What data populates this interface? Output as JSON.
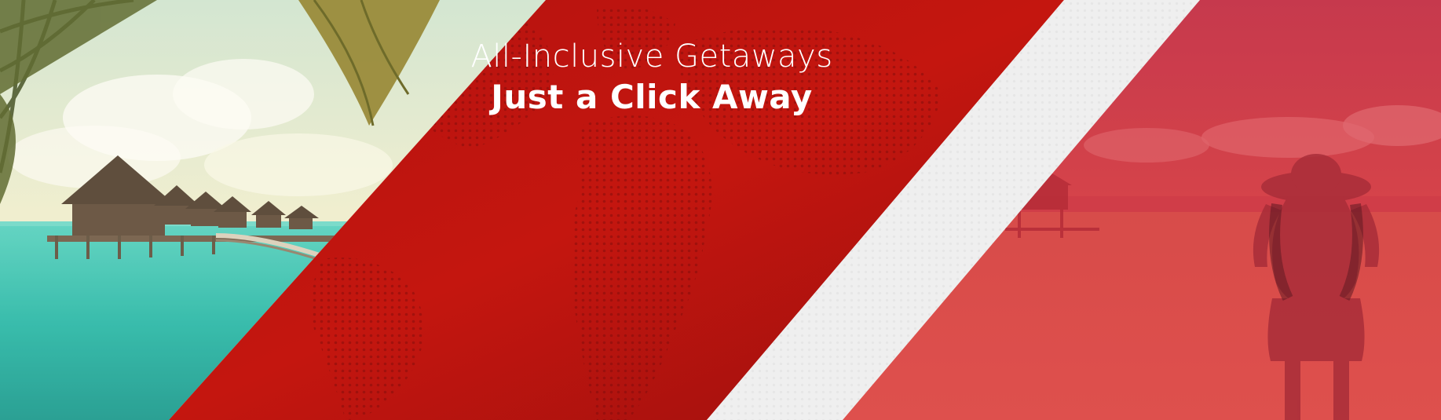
{
  "banner": {
    "headline_line1": "All-Inclusive Getaways",
    "headline_line2": "Just a Click Away"
  },
  "colors": {
    "primary_red": "#c0160f",
    "dark_red": "#9d1010",
    "light_stripe": "#f0f0f0",
    "right_overlay": "#d8334a",
    "sea_turquoise": "#2fc4b8",
    "sky_cream": "#eef0d6"
  },
  "images": {
    "left": "tropical-overwater-bungalows-photo",
    "right": "woman-in-sun-hat-on-beach-photo",
    "center_background": "dotted-world-map"
  }
}
